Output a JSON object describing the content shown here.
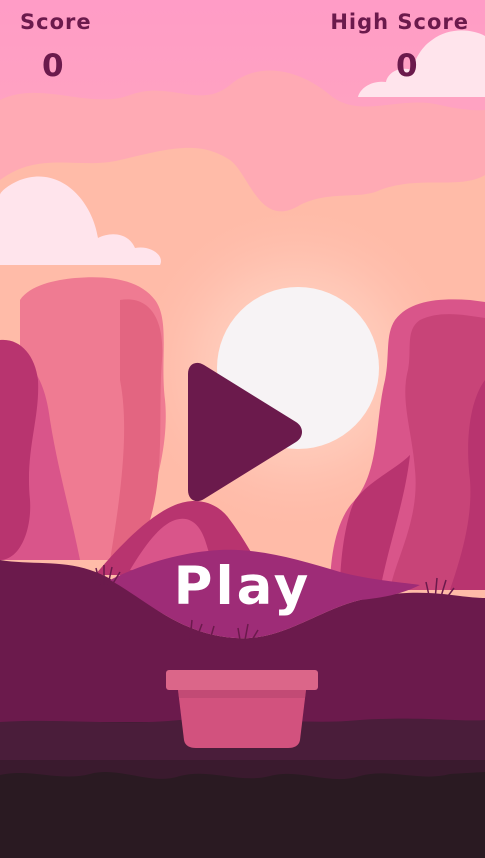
{
  "hud": {
    "score_label": "Score",
    "score_value": "0",
    "high_score_label": "High Score",
    "high_score_value": "0"
  },
  "menu": {
    "play_label": "Play",
    "play_icon": "play-triangle-icon"
  },
  "colors": {
    "sky_top": "#ff9cc6",
    "sky_glow": "#ffc6b4",
    "sun": "#f7f3f5",
    "cloud": "#ffe4ec",
    "rock_light": "#ef7b92",
    "rock_mid": "#d9558a",
    "rock_dark": "#b8346f",
    "hill_front": "#6b1a4c",
    "hill_accent": "#9e2c77",
    "ground_dark": "#2a1a22",
    "text": "#6b1a4c",
    "play_icon": "#6b1a4c",
    "play_text": "#ffffff",
    "pot": "#d2527e",
    "pot_rim": "#db6689"
  }
}
